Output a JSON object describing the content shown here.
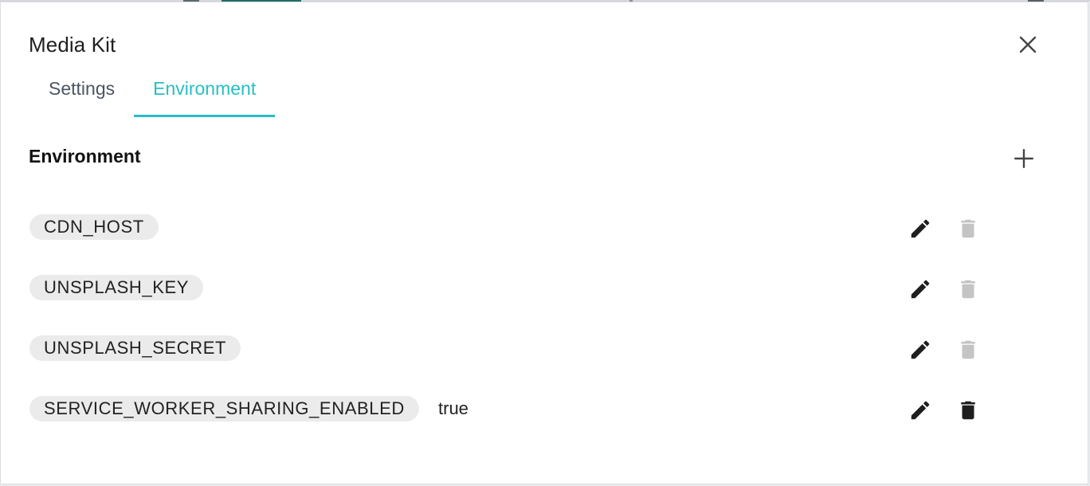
{
  "dialog": {
    "title": "Media Kit",
    "close_icon": "close-icon"
  },
  "tabs": [
    {
      "label": "Settings",
      "active": false
    },
    {
      "label": "Environment",
      "active": true
    }
  ],
  "colors": {
    "accent": "#26bfc4",
    "chip_bg": "#ebebeb",
    "icon_enabled": "#1f1f1f",
    "icon_disabled": "#c4c4c4"
  },
  "environment": {
    "title": "Environment",
    "add_icon": "plus-icon",
    "variables": [
      {
        "key": "CDN_HOST",
        "value": "",
        "delete_enabled": false
      },
      {
        "key": "UNSPLASH_KEY",
        "value": "",
        "delete_enabled": false
      },
      {
        "key": "UNSPLASH_SECRET",
        "value": "",
        "delete_enabled": false
      },
      {
        "key": "SERVICE_WORKER_SHARING_ENABLED",
        "value": "true",
        "delete_enabled": true
      }
    ]
  }
}
